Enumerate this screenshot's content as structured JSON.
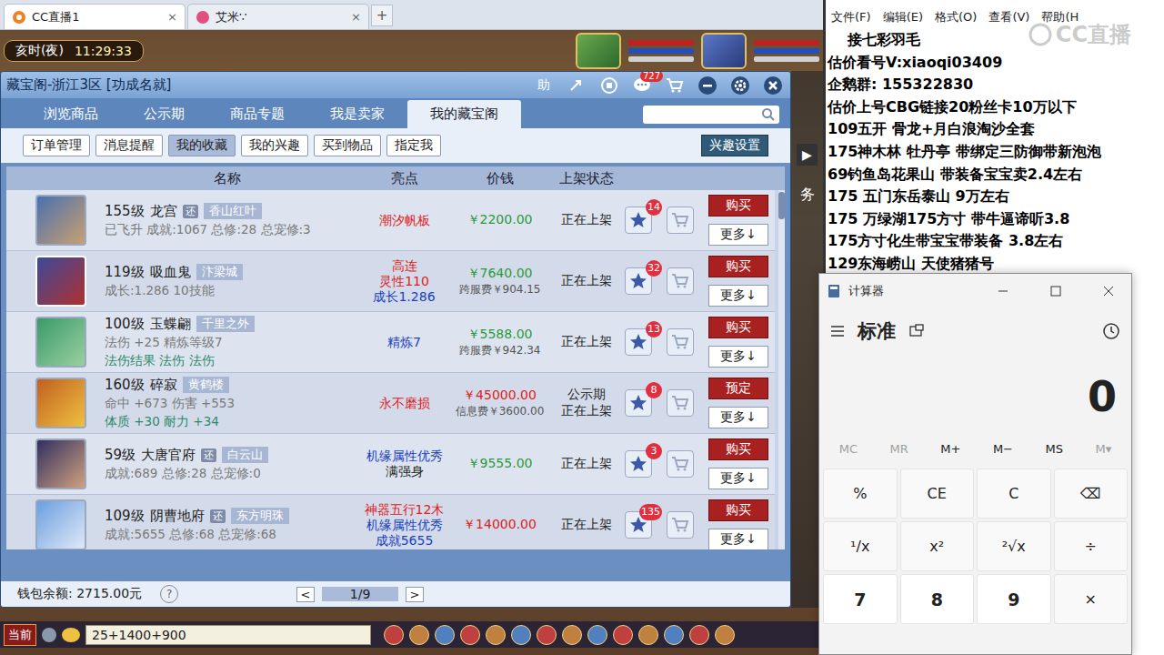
{
  "browser": {
    "tabs": [
      {
        "label": "CC直播1",
        "selected": true,
        "close": "×"
      },
      {
        "label": "艾米∵",
        "selected": false,
        "close": "×"
      }
    ],
    "new_tab": "+"
  },
  "game": {
    "period": "亥时(夜)",
    "clock": "11:29:33",
    "side_arrow": "▶",
    "side_label": "务",
    "chat_channel": "当前",
    "chat_input": "25+1400+900"
  },
  "cbg": {
    "title": "藏宝阁-浙江3区 [功成名就]",
    "help": "助",
    "message_badge": "727",
    "tabs": [
      {
        "label": "浏览商品",
        "selected": false
      },
      {
        "label": "公示期",
        "selected": false
      },
      {
        "label": "商品专题",
        "selected": false
      },
      {
        "label": "我是卖家",
        "selected": false
      },
      {
        "label": "我的藏宝阁",
        "selected": true
      }
    ],
    "filters": [
      {
        "label": "订单管理",
        "selected": false
      },
      {
        "label": "消息提醒",
        "selected": false
      },
      {
        "label": "我的收藏",
        "selected": true
      },
      {
        "label": "我的兴趣",
        "selected": false
      },
      {
        "label": "买到物品",
        "selected": false
      },
      {
        "label": "指定我",
        "selected": false
      }
    ],
    "interest_button": "兴趣设置",
    "columns": [
      "名称",
      "亮点",
      "价钱",
      "上架状态"
    ],
    "rows": [
      {
        "level": "155级",
        "name": "龙宫",
        "badge": "还",
        "server": "香山红叶",
        "details": [
          {
            "text": "已飞升 成就:1067 总修:28 总宠修:3",
            "color": "#7a7a7a"
          }
        ],
        "highlights": [
          {
            "text": "潮汐帆板",
            "color": "#e02020"
          }
        ],
        "price": "￥2200.00",
        "price_color": "#2a9a3a",
        "fee": "",
        "status": [
          "正在上架"
        ],
        "favorites": "14",
        "action": "购买",
        "more": "更多↓"
      },
      {
        "level": "119级",
        "name": "吸血鬼",
        "badge": "",
        "server": "汴梁城",
        "details": [
          {
            "text": "成长:1.286 10技能",
            "color": "#7a7a7a"
          }
        ],
        "highlights": [
          {
            "text": "高连",
            "color": "#e02020"
          },
          {
            "text": "灵性110",
            "color": "#e02020"
          },
          {
            "text": "成长1.286",
            "color": "#2040c0"
          }
        ],
        "price": "￥7640.00",
        "price_color": "#2a9a3a",
        "fee": "跨服费￥904.15",
        "status": [
          "正在上架"
        ],
        "favorites": "32",
        "action": "购买",
        "more": "更多↓"
      },
      {
        "level": "100级",
        "name": "玉蝶翩",
        "badge": "",
        "server": "千里之外",
        "details": [
          {
            "text": "法伤 +25 精炼等级7",
            "color": "#7a7a7a"
          },
          {
            "text": "法伤结果 法伤 法伤",
            "color": "#2f8a6a"
          }
        ],
        "highlights": [
          {
            "text": "精炼7",
            "color": "#2040c0"
          }
        ],
        "price": "￥5588.00",
        "price_color": "#2a9a3a",
        "fee": "跨服费￥942.34",
        "status": [
          "正在上架"
        ],
        "favorites": "13",
        "action": "购买",
        "more": "更多↓"
      },
      {
        "level": "160级",
        "name": "碎寂",
        "badge": "",
        "server": "黄鹤楼",
        "details": [
          {
            "text": "命中 +673 伤害 +553",
            "color": "#7a7a7a"
          },
          {
            "text": "体质 +30 耐力 +34",
            "color": "#2f8a6a"
          }
        ],
        "highlights": [
          {
            "text": "永不磨损",
            "color": "#e02020"
          }
        ],
        "price": "￥45000.00",
        "price_color": "#e02020",
        "fee": "信息费￥3600.00",
        "status": [
          "公示期",
          "正在上架"
        ],
        "favorites": "8",
        "action": "预定",
        "more": "更多↓"
      },
      {
        "level": "59级",
        "name": "大唐官府",
        "badge": "还",
        "server": "白云山",
        "details": [
          {
            "text": "成就:689 总修:28 总宠修:0",
            "color": "#7a7a7a"
          }
        ],
        "highlights": [
          {
            "text": "机缘属性优秀",
            "color": "#2040c0"
          },
          {
            "text": "满强身",
            "color": "#222222"
          }
        ],
        "price": "￥9555.00",
        "price_color": "#2a9a3a",
        "fee": "",
        "status": [
          "正在上架"
        ],
        "favorites": "3",
        "action": "购买",
        "more": "更多↓"
      },
      {
        "level": "109级",
        "name": "阴曹地府",
        "badge": "还",
        "server": "东方明珠",
        "details": [
          {
            "text": "成就:5655 总修:68 总宠修:68",
            "color": "#7a7a7a"
          }
        ],
        "highlights": [
          {
            "text": "神器五行12木",
            "color": "#e02020"
          },
          {
            "text": "机缘属性优秀",
            "color": "#2040c0"
          },
          {
            "text": "成就5655",
            "color": "#2040c0"
          }
        ],
        "price": "￥14000.00",
        "price_color": "#e02020",
        "fee": "",
        "status": [
          "正在上架"
        ],
        "favorites": "135",
        "action": "购买",
        "more": "更多↓"
      }
    ],
    "wallet": "钱包余额: 2715.00元",
    "help_icon": "?",
    "prev": "<",
    "page": "1/9",
    "next": ">"
  },
  "notepad": {
    "menu": [
      "文件(F)",
      "编辑(E)",
      "格式(O)",
      "查看(V)",
      "帮助(H"
    ],
    "lines": [
      "接七彩羽毛",
      "估价看号V:xiaoqi03409",
      "企鹅群: 155322830",
      "估价上号CBG链接20粉丝卡10万以下",
      "109五开 骨龙+月白浪淘沙全套",
      "175神木林 牡丹亭 带绑定三防御带新泡泡",
      "69钓鱼岛花果山 带装备宝宝卖2.4左右",
      "175 五门东岳泰山 9万左右",
      "175 万绿湖175方寸 带牛逼谛听3.8",
      "175方寸化生带宝宝带装备 3.8左右",
      "129东海崂山 天使猪猪号"
    ],
    "watermark": "CC直播"
  },
  "calculator": {
    "title": "计算器",
    "mode": "标准",
    "display": "0",
    "memory": [
      {
        "label": "MC",
        "disabled": true
      },
      {
        "label": "MR",
        "disabled": true
      },
      {
        "label": "M+",
        "disabled": false
      },
      {
        "label": "M−",
        "disabled": false
      },
      {
        "label": "MS",
        "disabled": false
      },
      {
        "label": "M▾",
        "disabled": true
      }
    ],
    "keys": [
      {
        "label": "%",
        "kind": "op"
      },
      {
        "label": "CE",
        "kind": "op"
      },
      {
        "label": "C",
        "kind": "op"
      },
      {
        "label": "⌫",
        "kind": "op"
      },
      {
        "label": "¹/x",
        "kind": "op"
      },
      {
        "label": "x²",
        "kind": "op"
      },
      {
        "label": "²√x",
        "kind": "op"
      },
      {
        "label": "÷",
        "kind": "op"
      },
      {
        "label": "7",
        "kind": "num"
      },
      {
        "label": "8",
        "kind": "num"
      },
      {
        "label": "9",
        "kind": "num"
      },
      {
        "label": "×",
        "kind": "op"
      }
    ]
  }
}
